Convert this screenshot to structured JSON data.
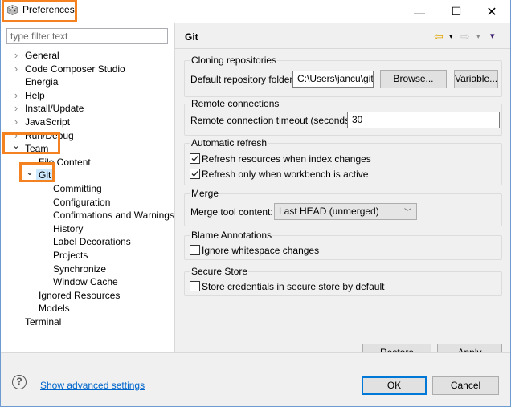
{
  "window": {
    "title": "Preferences",
    "controls": {
      "minimize": "—",
      "maximize": "☐",
      "close": "✕"
    }
  },
  "sidebar": {
    "filter_placeholder": "type filter text",
    "tree": [
      {
        "label": "General",
        "level": 0,
        "expander": "collapsed"
      },
      {
        "label": "Code Composer Studio",
        "level": 0,
        "expander": "collapsed"
      },
      {
        "label": "Energia",
        "level": 0,
        "expander": "none"
      },
      {
        "label": "Help",
        "level": 0,
        "expander": "collapsed"
      },
      {
        "label": "Install/Update",
        "level": 0,
        "expander": "collapsed"
      },
      {
        "label": "JavaScript",
        "level": 0,
        "expander": "collapsed"
      },
      {
        "label": "Run/Debug",
        "level": 0,
        "expander": "collapsed"
      },
      {
        "label": "Team",
        "level": 0,
        "expander": "expanded",
        "highlighted": true
      },
      {
        "label": "File Content",
        "level": 1,
        "expander": "none"
      },
      {
        "label": "Git",
        "level": 1,
        "expander": "expanded",
        "selected": true,
        "highlighted": true
      },
      {
        "label": "Committing",
        "level": 2,
        "expander": "none"
      },
      {
        "label": "Configuration",
        "level": 2,
        "expander": "none"
      },
      {
        "label": "Confirmations and Warnings",
        "level": 2,
        "expander": "none"
      },
      {
        "label": "History",
        "level": 2,
        "expander": "none"
      },
      {
        "label": "Label Decorations",
        "level": 2,
        "expander": "none"
      },
      {
        "label": "Projects",
        "level": 2,
        "expander": "none"
      },
      {
        "label": "Synchronize",
        "level": 2,
        "expander": "none"
      },
      {
        "label": "Window Cache",
        "level": 2,
        "expander": "none"
      },
      {
        "label": "Ignored Resources",
        "level": 1,
        "expander": "none"
      },
      {
        "label": "Models",
        "level": 1,
        "expander": "none"
      },
      {
        "label": "Terminal",
        "level": 0,
        "expander": "none"
      }
    ]
  },
  "page": {
    "title": "Git",
    "nav": {
      "back": "⇦",
      "forward": "⇨",
      "dropdown": "▾",
      "menu": "▾"
    },
    "groups": {
      "cloning": {
        "label": "Cloning repositories",
        "folder_label": "Default repository folder:",
        "folder_value": "C:\\Users\\jancu\\git",
        "browse_button": "Browse...",
        "variable_button": "Variable..."
      },
      "remote": {
        "label": "Remote connections",
        "timeout_label": "Remote connection timeout (seconds):",
        "timeout_value": "30"
      },
      "refresh": {
        "label": "Automatic refresh",
        "options": [
          {
            "label": "Refresh resources when index changes",
            "checked": true
          },
          {
            "label": "Refresh only when workbench is active",
            "checked": true
          }
        ]
      },
      "merge": {
        "label": "Merge",
        "tool_label": "Merge tool content:",
        "tool_value": "Last HEAD (unmerged)"
      },
      "blame": {
        "label": "Blame Annotations",
        "options": [
          {
            "label": "Ignore whitespace changes",
            "checked": false
          }
        ]
      },
      "secure": {
        "label": "Secure Store",
        "options": [
          {
            "label": "Store credentials in secure store by default",
            "checked": false
          }
        ]
      }
    },
    "restore_defaults_button": "Restore Defaults",
    "apply_button": "Apply"
  },
  "footer": {
    "help_icon": "?",
    "advanced_link": "Show advanced settings",
    "ok_button": "OK",
    "cancel_button": "Cancel"
  },
  "colors": {
    "highlight_border": "#f58220",
    "selection": "#cce8ff",
    "link": "#0066cc",
    "default_button_border": "#0078d7"
  }
}
